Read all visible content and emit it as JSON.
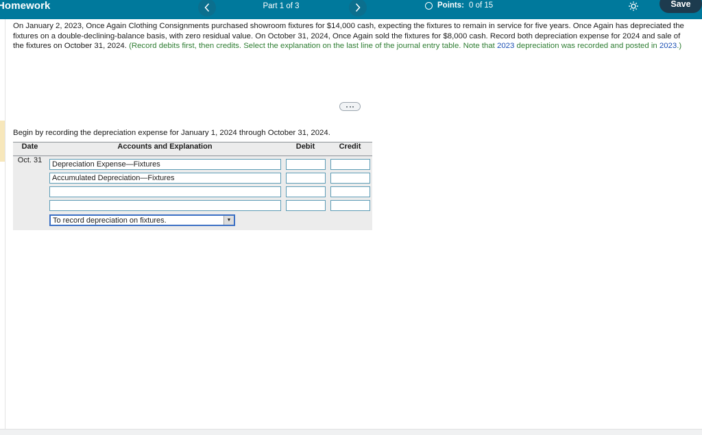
{
  "header": {
    "title": "Homework",
    "prev_icon": "chevron-left-icon",
    "next_icon": "chevron-right-icon",
    "part_label": "Part 1 of 3",
    "points_icon": "circle-icon",
    "points_label": "Points:",
    "points_value": "0 of 15",
    "gear_icon": "gear-icon",
    "save_label": "Save",
    "bg_color": "#00799c",
    "save_color": "#1d3b4e"
  },
  "problem": {
    "sentence_1": "On January 2, 2023, Once Again Clothing Consignments purchased showroom fixtures for $14,000 cash, expecting the fixtures to remain in service for five years. Once Again has depreciated the fixtures on a double-declining-balance basis, with zero residual value. On October 31, 2024, Once Again sold the fixtures for $8,000 cash. Record both depreciation expense for 2024 and sale of the fixtures on October 31, 2024. ",
    "hint_a": "(Record debits first, then credits. Select the explanation on the last line of the journal entry table. Note that ",
    "hint_year_1": "2023",
    "hint_b": " depreciation was recorded and posted in ",
    "hint_year_2": "2023",
    "hint_c": ".)",
    "hint_color": "#2e7d32",
    "hint_year_color": "#1a4fb4"
  },
  "expander": {
    "icon": "ellipsis-icon"
  },
  "instruction": {
    "text": "Begin by recording the depreciation expense for January 1, 2024 through October 31, 2024."
  },
  "table": {
    "columns": {
      "date": "Date",
      "accounts": "Accounts and Explanation",
      "debit": "Debit",
      "credit": "Credit"
    },
    "date_value": "Oct. 31",
    "rows": [
      {
        "account": "Depreciation Expense—Fixtures",
        "debit": "",
        "credit": ""
      },
      {
        "account": "Accumulated Depreciation—Fixtures",
        "debit": "",
        "credit": ""
      },
      {
        "account": "",
        "debit": "",
        "credit": ""
      },
      {
        "account": "",
        "debit": "",
        "credit": ""
      }
    ],
    "explanation": {
      "selected": "To record depreciation on fixtures.",
      "arrow_icon": "caret-down-icon"
    }
  }
}
